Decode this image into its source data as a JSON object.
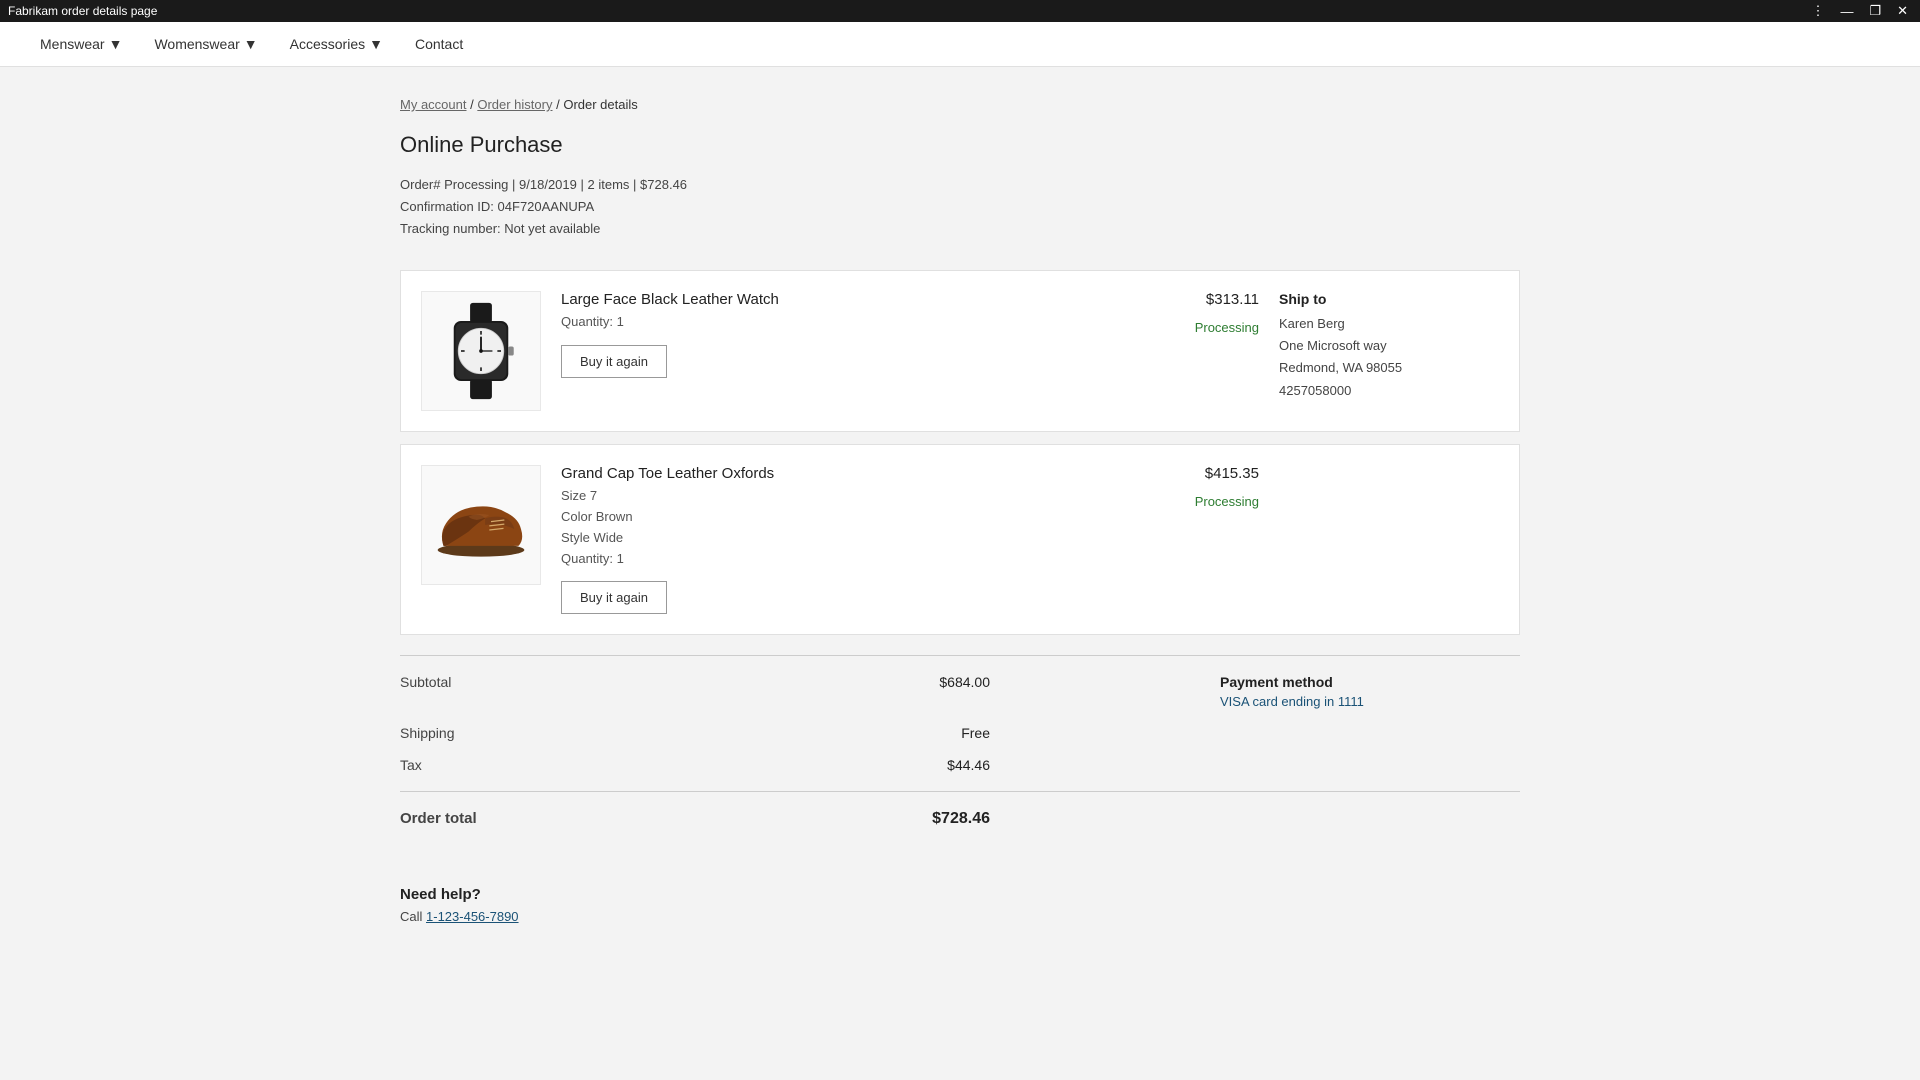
{
  "titlebar": {
    "title": "Fabrikam order details page",
    "more_icon": "⋮",
    "minimize": "—",
    "restore": "❐",
    "close": "✕"
  },
  "nav": {
    "items": [
      {
        "label": "Menswear",
        "has_dropdown": true
      },
      {
        "label": "Womenswear",
        "has_dropdown": true
      },
      {
        "label": "Accessories",
        "has_dropdown": true
      },
      {
        "label": "Contact",
        "has_dropdown": false
      }
    ]
  },
  "breadcrumb": {
    "my_account": "My account",
    "order_history": "Order history",
    "current": "Order details",
    "separator": " / "
  },
  "page": {
    "title": "Online Purchase",
    "order_number_label": "Order#",
    "order_status": "Processing",
    "order_date": "9/18/2019",
    "items_count": "2 items",
    "order_total_summary": "$728.46",
    "confirmation_label": "Confirmation ID:",
    "confirmation_id": "04F720AANUPA",
    "tracking_label": "Tracking number:",
    "tracking_value": "Not yet available"
  },
  "items": [
    {
      "id": "item-1",
      "name": "Large Face Black Leather Watch",
      "quantity_label": "Quantity:",
      "quantity": "1",
      "price": "$313.11",
      "status": "Processing",
      "buy_again_label": "Buy it again",
      "image_type": "watch"
    },
    {
      "id": "item-2",
      "name": "Grand Cap Toe Leather Oxfords",
      "size_label": "Size",
      "size": "7",
      "color_label": "Color",
      "color": "Brown",
      "style_label": "Style",
      "style": "Wide",
      "quantity_label": "Quantity:",
      "quantity": "1",
      "price": "$415.35",
      "status": "Processing",
      "buy_again_label": "Buy it again",
      "image_type": "shoe"
    }
  ],
  "ship_to": {
    "title": "Ship to",
    "name": "Karen Berg",
    "address1": "One Microsoft way",
    "city_state": "Redmond, WA 98055",
    "phone": "4257058000"
  },
  "summary": {
    "subtotal_label": "Subtotal",
    "subtotal": "$684.00",
    "shipping_label": "Shipping",
    "shipping": "Free",
    "tax_label": "Tax",
    "tax": "$44.46",
    "total_label": "Order total",
    "total": "$728.46"
  },
  "payment": {
    "title": "Payment method",
    "detail_prefix": "VISA card ending in ",
    "last_four": "1111"
  },
  "help": {
    "title": "Need help?",
    "call_label": "Call ",
    "phone": "1-123-456-7890"
  }
}
